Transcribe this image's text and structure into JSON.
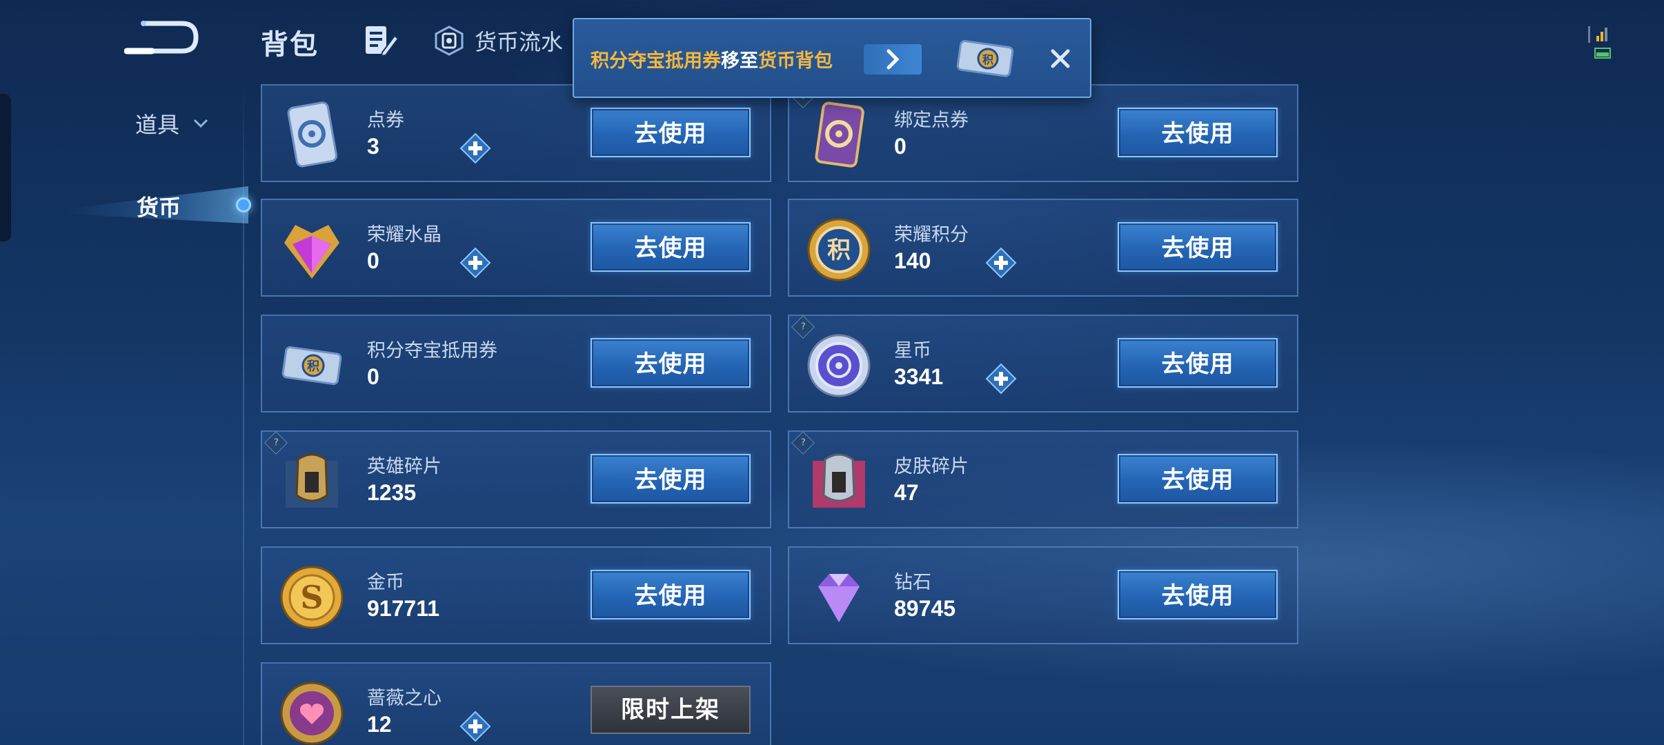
{
  "header": {
    "title": "背包",
    "flow_tab_label": "货币流水"
  },
  "sidebar": {
    "items": [
      {
        "label": "道具"
      },
      {
        "label": "货币"
      }
    ]
  },
  "banner": {
    "part1": "积分夺宝抵用券",
    "part2": "移至",
    "part3": "货币背包"
  },
  "currencies": [
    {
      "name": "点券",
      "amount": "3",
      "button": "去使用",
      "icon": "coupon-icon"
    },
    {
      "name": "绑定点券",
      "amount": "0",
      "button": "去使用",
      "icon": "bound-coupon-icon"
    },
    {
      "name": "荣耀水晶",
      "amount": "0",
      "button": "去使用",
      "icon": "glory-crystal-icon"
    },
    {
      "name": "荣耀积分",
      "amount": "140",
      "button": "去使用",
      "icon": "glory-points-icon"
    },
    {
      "name": "积分夺宝抵用券",
      "amount": "0",
      "button": "去使用",
      "icon": "lottery-voucher-icon"
    },
    {
      "name": "星币",
      "amount": "3341",
      "button": "去使用",
      "icon": "star-coin-icon"
    },
    {
      "name": "英雄碎片",
      "amount": "1235",
      "button": "去使用",
      "icon": "hero-fragment-icon"
    },
    {
      "name": "皮肤碎片",
      "amount": "47",
      "button": "去使用",
      "icon": "skin-fragment-icon"
    },
    {
      "name": "金币",
      "amount": "917711",
      "button": "去使用",
      "icon": "gold-coin-icon"
    },
    {
      "name": "钻石",
      "amount": "89745",
      "button": "去使用",
      "icon": "diamond-icon"
    },
    {
      "name": "蔷薇之心",
      "amount": "12",
      "button": "限时上架",
      "icon": "rose-heart-icon"
    }
  ],
  "colors": {
    "accent_blue": "#2465b4",
    "highlight_gold": "#f3b73e",
    "background": "#143665"
  }
}
